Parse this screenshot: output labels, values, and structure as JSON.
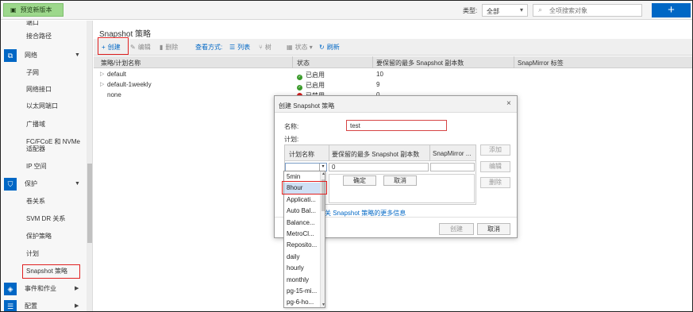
{
  "topbar": {
    "preview_label": "预览新版本",
    "type_label": "类型:",
    "type_value": "全部",
    "search_placeholder": "全项搜索对象",
    "add_label": "+",
    "accent_color": "#0067c5",
    "preview_color": "#9dd88c"
  },
  "sidebar": {
    "items_top": [
      "端口",
      "接合路径"
    ],
    "network": {
      "label": "网络",
      "items": [
        "子网",
        "网络接口",
        "以太网端口",
        "广播域",
        "FC/FCoE 和 NVMe 适配器",
        "IP 空间"
      ]
    },
    "protection": {
      "label": "保护",
      "items": [
        "卷关系",
        "SVM DR 关系",
        "保护策略",
        "计划",
        "Snapshot 策略"
      ]
    },
    "events_label": "事件和作业",
    "config_label": "配置"
  },
  "main": {
    "title": "Snapshot 策略",
    "toolbar": {
      "create": "创建",
      "edit": "编辑",
      "delete": "删除",
      "view_mode": "查看方式:",
      "list": "列表",
      "tree": "树",
      "status": "状态",
      "refresh": "刷新"
    },
    "columns": [
      "策略/计划名称",
      "状态",
      "要保留的最多 Snapshot 副本数",
      "SnapMirror 标签"
    ],
    "rows": [
      {
        "name": "default",
        "status": "已启用",
        "count": "10"
      },
      {
        "name": "default-1weekly",
        "status": "已启用",
        "count": "9"
      },
      {
        "name": "none",
        "status": "已禁用",
        "count": "0"
      }
    ]
  },
  "dialog": {
    "title": "创建 Snapshot 策略",
    "name_label": "名称:",
    "name_value": "test",
    "schedule_label": "计划:",
    "sched_columns": [
      "计划名称",
      "要保留的最多 Snapshot 副本数",
      "SnapMirror ..."
    ],
    "count_value": "0",
    "ok_label": "确定",
    "cancel_inline": "取消",
    "side_add": "添加",
    "side_edit": "编辑",
    "side_delete": "删除",
    "more_info": "有关 Snapshot 策略的更多信息",
    "create_label": "创建",
    "cancel_label": "取消"
  },
  "dropdown": {
    "options": [
      "5min",
      "8hour",
      "Applicati...",
      "Auto Bal...",
      "Balance...",
      "MetroCl...",
      "Reposito...",
      "daily",
      "hourly",
      "monthly",
      "pg-15-mi...",
      "pg-6-ho..."
    ],
    "selected": "8hour"
  }
}
